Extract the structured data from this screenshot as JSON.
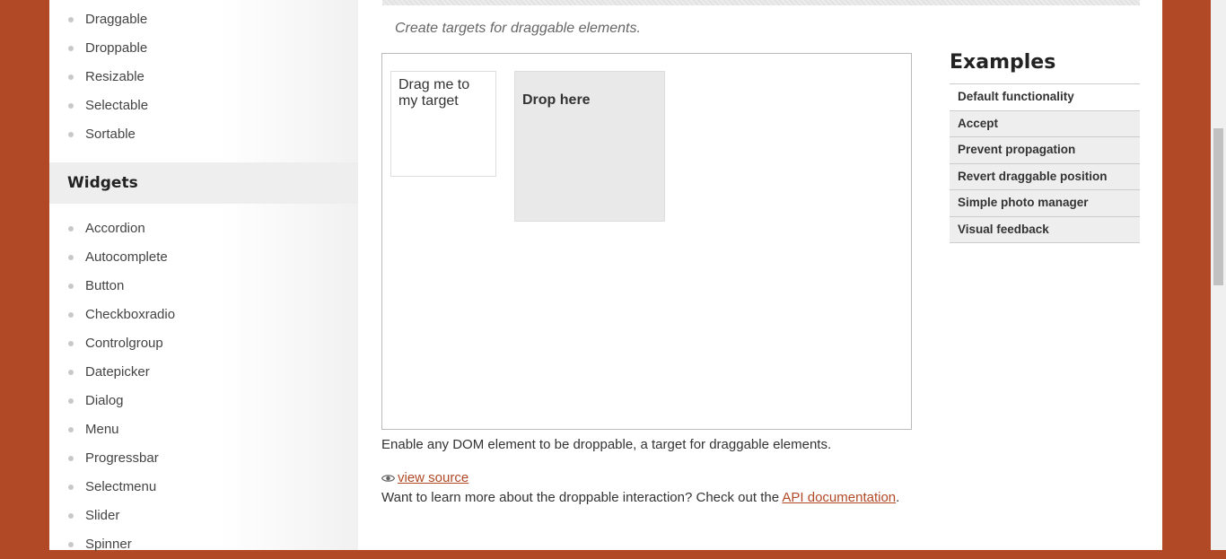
{
  "sidebar": {
    "interactions": [
      "Draggable",
      "Droppable",
      "Resizable",
      "Selectable",
      "Sortable"
    ],
    "widgets_heading": "Widgets",
    "widgets": [
      "Accordion",
      "Autocomplete",
      "Button",
      "Checkboxradio",
      "Controlgroup",
      "Datepicker",
      "Dialog",
      "Menu",
      "Progressbar",
      "Selectmenu",
      "Slider",
      "Spinner"
    ]
  },
  "main": {
    "subtitle": "Create targets for draggable elements.",
    "demo": {
      "draggable_label": "Drag me to my target",
      "droppable_label": "Drop here"
    },
    "description": "Enable any DOM element to be droppable, a target for draggable elements.",
    "view_source_label": "view source",
    "learn_more_text": "Want to learn more about the droppable interaction? Check out the ",
    "api_link_label": "API documentation",
    "learn_more_suffix": "."
  },
  "examples": {
    "title": "Examples",
    "items": [
      "Default functionality",
      "Accept",
      "Prevent propagation",
      "Revert draggable position",
      "Simple photo manager",
      "Visual feedback"
    ]
  },
  "colors": {
    "brand": "#b24926",
    "link": "#b24926"
  },
  "icons": {
    "view_source": "eye-icon",
    "list_bullet": "bullet-icon"
  }
}
